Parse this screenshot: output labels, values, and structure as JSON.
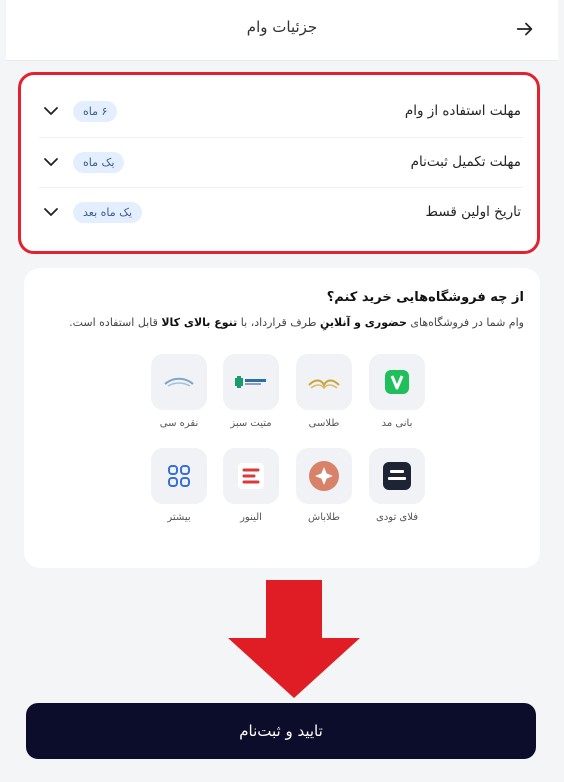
{
  "header": {
    "title": "جزئیات وام",
    "back_icon": "arrow-right-icon"
  },
  "details": {
    "rows": [
      {
        "label": "مهلت استفاده از وام",
        "value": "۶ ماه"
      },
      {
        "label": "مهلت تکمیل ثبت‌نام",
        "value": "یک ماه"
      },
      {
        "label": "تاریخ اولین قسط",
        "value": "یک ماه بعد"
      }
    ]
  },
  "stores": {
    "question": "از چه فروشگاه‌هایی خرید کنم؟",
    "desc_part1": "وام شما در فروشگاه‌های ",
    "desc_bold1": "حضوری و آنلاینِ",
    "desc_part2": " طرف قرارداد، با ",
    "desc_bold2": "تنوع بالای کالا",
    "desc_part3": " قابل استفاده است.",
    "items": [
      {
        "name": "بانی مد"
      },
      {
        "name": "طلاسی"
      },
      {
        "name": "متیت سبز"
      },
      {
        "name": "نقره سی"
      },
      {
        "name": "فلای تودی"
      },
      {
        "name": "طلاباش"
      },
      {
        "name": "الینور"
      },
      {
        "name": "بیشتر"
      }
    ]
  },
  "submit": {
    "label": "تایید و ثبت‌نام"
  },
  "colors": {
    "highlight": "#e0232e",
    "primary": "#0b0d2b",
    "badge_bg": "#e3efff"
  }
}
